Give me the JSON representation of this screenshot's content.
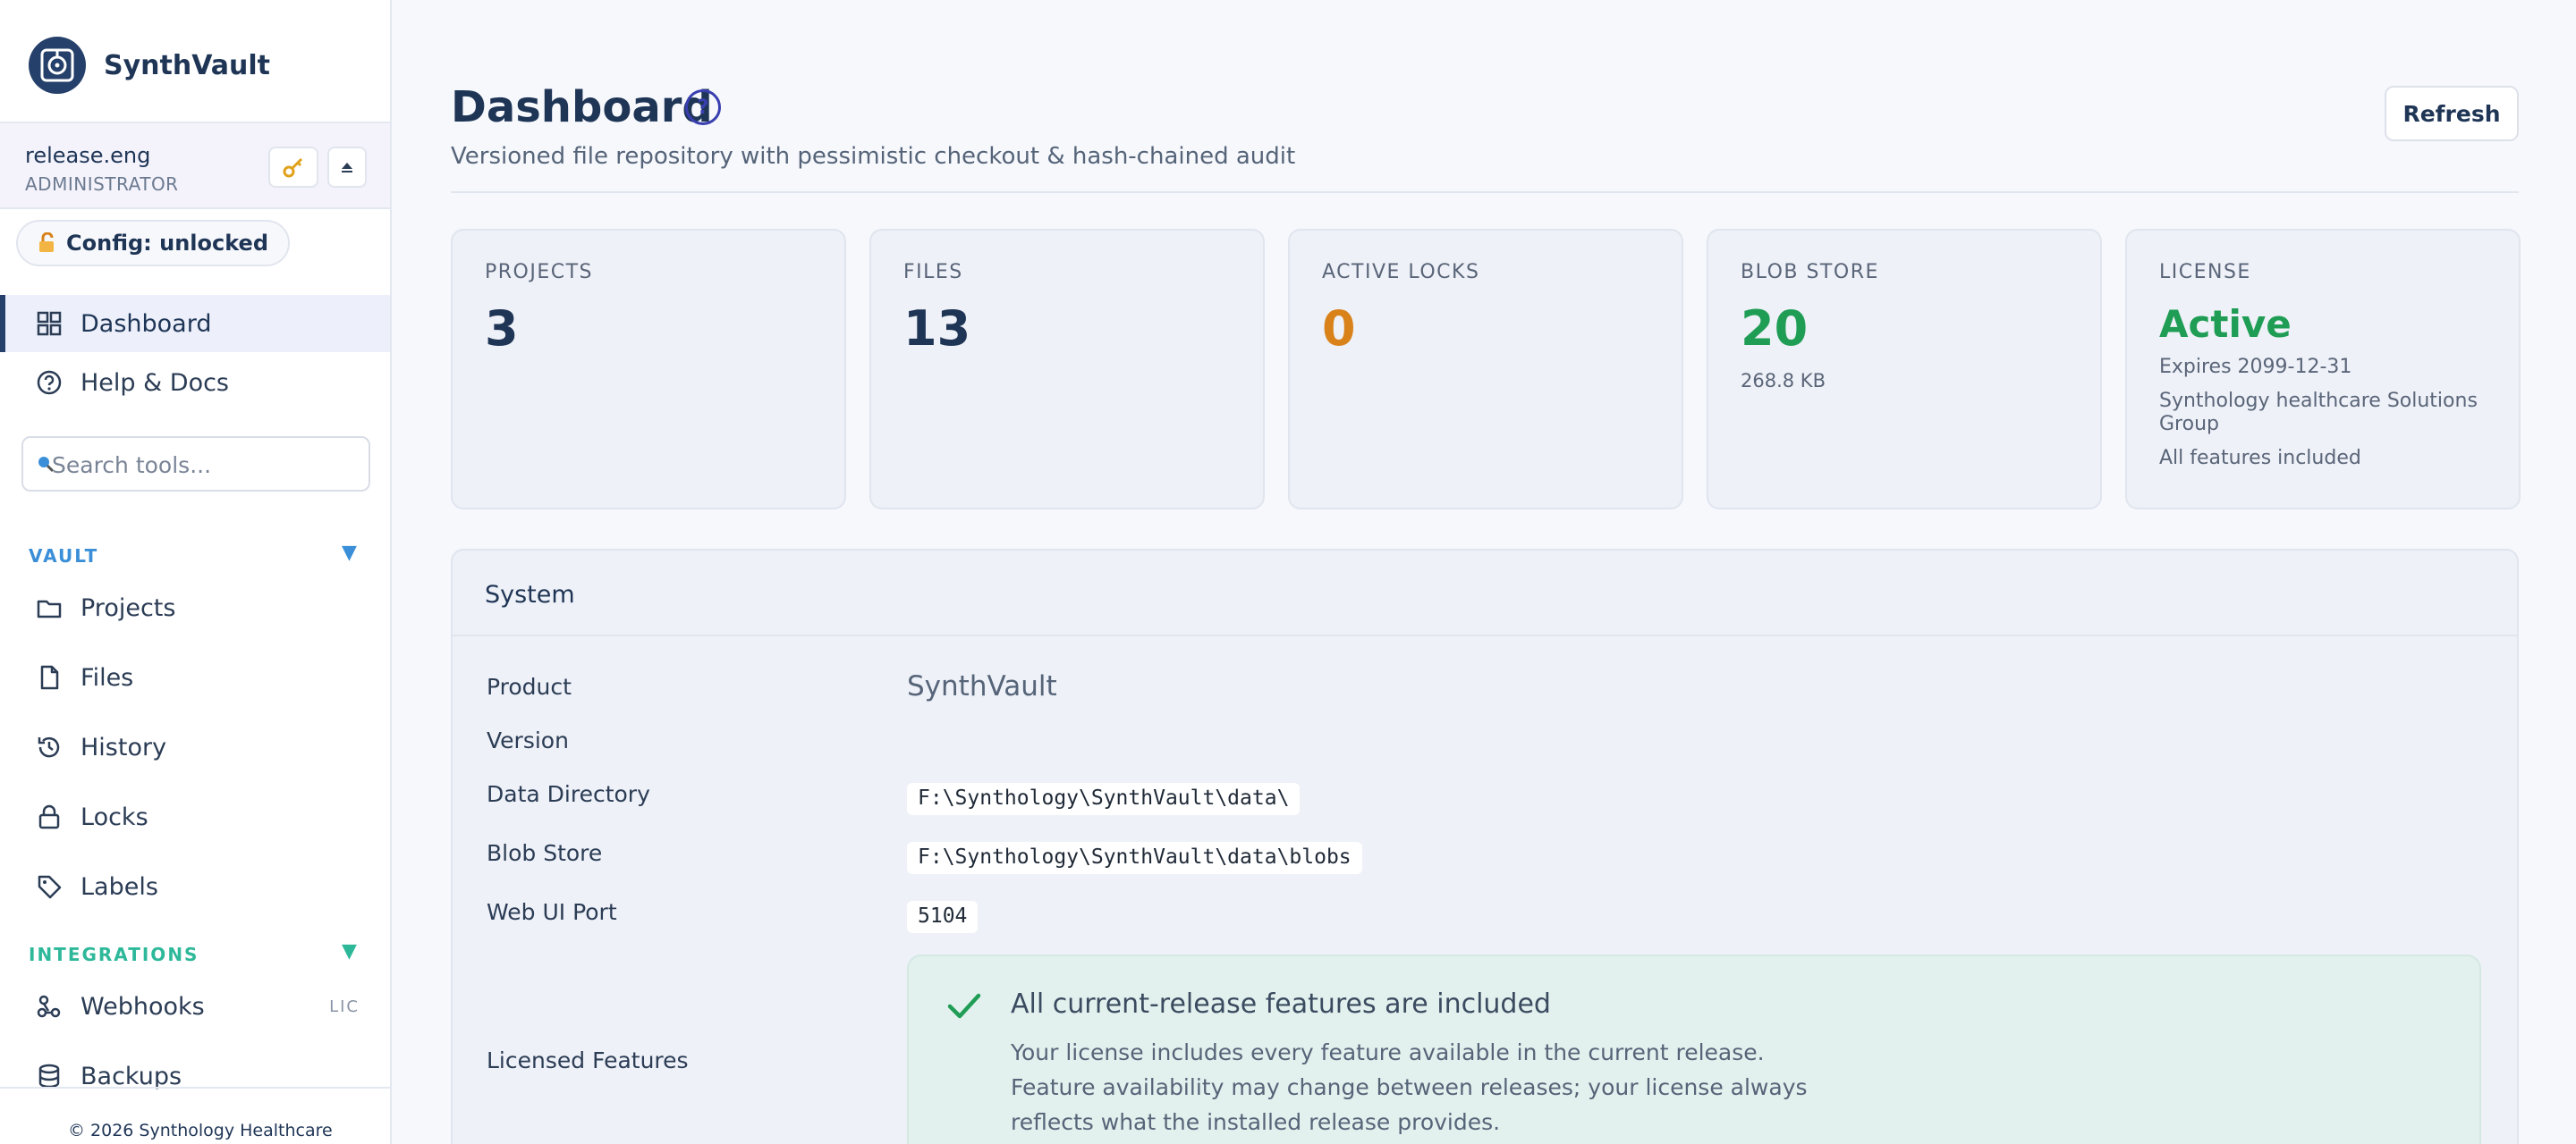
{
  "brand": {
    "name": "SynthVault"
  },
  "user": {
    "name": "release.eng",
    "role": "ADMINISTRATOR"
  },
  "config": {
    "label": "Config: unlocked"
  },
  "nav": {
    "dashboard": "Dashboard",
    "help": "Help & Docs"
  },
  "search": {
    "placeholder": "Search tools..."
  },
  "sections": {
    "vault": {
      "label": "VAULT",
      "color": "#3b8fd8",
      "items": [
        "Projects",
        "Files",
        "History",
        "Locks",
        "Labels"
      ]
    },
    "integrations": {
      "label": "INTEGRATIONS",
      "color": "#2eb89a",
      "items": [
        "Webhooks",
        "Backups"
      ],
      "webhooks_badge": "LIC"
    }
  },
  "footer": {
    "copyright": "© 2026 Synthology Healthcare"
  },
  "header": {
    "title": "Dashboard",
    "help_glyph": "?",
    "subtitle": "Versioned file repository with pessimistic checkout & hash-chained audit",
    "refresh_label": "Refresh"
  },
  "stats": {
    "projects": {
      "label": "PROJECTS",
      "value": "3",
      "color": "#1f3556"
    },
    "files": {
      "label": "FILES",
      "value": "13",
      "color": "#1f3556"
    },
    "locks": {
      "label": "ACTIVE LOCKS",
      "value": "0",
      "color": "#d9821a"
    },
    "blob": {
      "label": "BLOB STORE",
      "value": "20",
      "sub": "268.8 KB",
      "color": "#1f9d55"
    },
    "license": {
      "label": "LICENSE",
      "value": "Active",
      "expires": "Expires 2099-12-31",
      "owner": "Synthology healthcare Solutions Group",
      "features": "All features included",
      "color": "#1f9d55"
    }
  },
  "system": {
    "title": "System",
    "labels": {
      "product": "Product",
      "version": "Version",
      "data_dir": "Data Directory",
      "blob_store": "Blob Store",
      "port": "Web UI Port",
      "features": "Licensed Features"
    },
    "values": {
      "product": "SynthVault",
      "data_dir": "F:\\Synthology\\SynthVault\\data\\",
      "blob_store": "F:\\Synthology\\SynthVault\\data\\blobs",
      "port": "5104"
    },
    "feature_box": {
      "title": "All current-release features are included",
      "text": "Your license includes every feature available in the current release. Feature availability may change between releases; your license always reflects what the installed release provides."
    }
  }
}
